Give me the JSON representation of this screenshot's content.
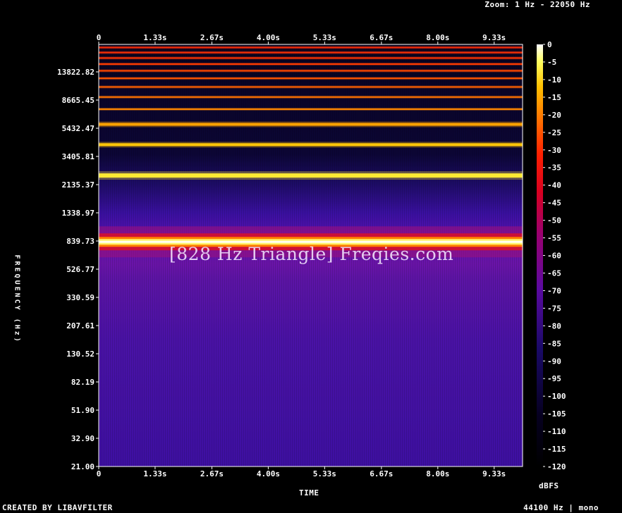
{
  "header": {
    "zoom": "Zoom: 1 Hz - 22050 Hz"
  },
  "footer": {
    "created": "CREATED BY LIBAVFILTER",
    "info": "44100 Hz | mono"
  },
  "watermark": "[828 Hz Triangle] Freqies.com",
  "chart_data": {
    "type": "heatmap",
    "title": "",
    "xlabel": "TIME",
    "ylabel": "FREQUENCY (Hz)",
    "x_ticks": [
      "0",
      "1.33s",
      "2.67s",
      "4.00s",
      "5.33s",
      "6.67s",
      "8.00s",
      "9.33s"
    ],
    "x_tick_values": [
      0,
      1.33,
      2.67,
      4.0,
      5.33,
      6.67,
      8.0,
      9.33
    ],
    "xlim": [
      0,
      10
    ],
    "y_ticks": [
      "13822.82",
      "8665.45",
      "5432.47",
      "3405.81",
      "2135.37",
      "1338.97",
      "839.73",
      "526.77",
      "330.59",
      "207.61",
      "130.52",
      "82.19",
      "51.90",
      "32.90",
      "21.00"
    ],
    "y_tick_values": [
      13822.82,
      8665.45,
      5432.47,
      3405.81,
      2135.37,
      1338.97,
      839.73,
      526.77,
      330.59,
      207.61,
      130.52,
      82.19,
      51.9,
      32.9,
      21.0
    ],
    "ylim": [
      21,
      22050
    ],
    "y_scale": "log",
    "colorbar": {
      "unit": "dBFS",
      "ticks": [
        "0",
        "-5",
        "-10",
        "-15",
        "-20",
        "-25",
        "-30",
        "-35",
        "-40",
        "-45",
        "-50",
        "-55",
        "-60",
        "-65",
        "-70",
        "-75",
        "-80",
        "-85",
        "-90",
        "-95",
        "-100",
        "-105",
        "-110",
        "-115",
        "-120"
      ],
      "tick_values": [
        0,
        -5,
        -10,
        -15,
        -20,
        -25,
        -30,
        -35,
        -40,
        -45,
        -50,
        -55,
        -60,
        -65,
        -70,
        -75,
        -80,
        -85,
        -90,
        -95,
        -100,
        -105,
        -110,
        -115,
        -120
      ],
      "range": [
        -120,
        0
      ]
    },
    "harmonics": [
      {
        "freq": 828,
        "level_db": 0
      },
      {
        "freq": 2484,
        "level_db": -19
      },
      {
        "freq": 4140,
        "level_db": -28
      },
      {
        "freq": 5796,
        "level_db": -34
      },
      {
        "freq": 7452,
        "level_db": -38
      },
      {
        "freq": 9108,
        "level_db": -41
      },
      {
        "freq": 10764,
        "level_db": -44
      },
      {
        "freq": 12420,
        "level_db": -46
      },
      {
        "freq": 14076,
        "level_db": -48
      },
      {
        "freq": 15732,
        "level_db": -50
      },
      {
        "freq": 17388,
        "level_db": -52
      },
      {
        "freq": 19044,
        "level_db": -53
      },
      {
        "freq": 20700,
        "level_db": -54
      }
    ],
    "background_db": -90,
    "grid": false
  }
}
